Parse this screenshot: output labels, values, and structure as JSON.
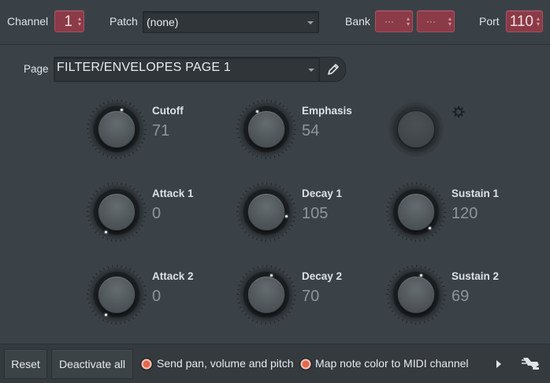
{
  "header": {
    "channel_label": "Channel",
    "channel_value": "1",
    "patch_label": "Patch",
    "patch_value": "(none)",
    "bank_label": "Bank",
    "bank_value_1": "···",
    "bank_value_2": "···",
    "port_label": "Port",
    "port_value": "110"
  },
  "page": {
    "label": "Page",
    "value": "FILTER/ENVELOPES PAGE 1",
    "edit_icon": "pencil-icon"
  },
  "knobs": [
    {
      "name": "Cutoff",
      "value": "71"
    },
    {
      "name": "Emphasis",
      "value": "54"
    },
    {
      "name": "",
      "value": ""
    },
    {
      "name": "Attack 1",
      "value": "0"
    },
    {
      "name": "Decay 1",
      "value": "105"
    },
    {
      "name": "Sustain 1",
      "value": "120"
    },
    {
      "name": "Attack 2",
      "value": "0"
    },
    {
      "name": "Decay 2",
      "value": "70"
    },
    {
      "name": "Sustain 2",
      "value": "69"
    }
  ],
  "settings_icon": "gear-icon",
  "footer": {
    "reset_label": "Reset",
    "deactivate_label": "Deactivate all",
    "send_label": "Send pan, volume and pitch",
    "map_label": "Map note color to MIDI channel",
    "more_icon": "triangle-right-icon",
    "plug_icon": "plug-icon"
  },
  "colors": {
    "background": "#3b4247",
    "accent_red": "#8b3a47",
    "check_orange": "#e8664a"
  }
}
